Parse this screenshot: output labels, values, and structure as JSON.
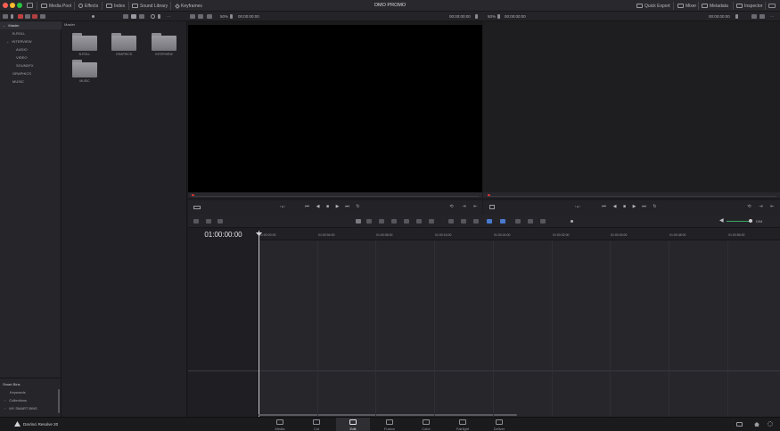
{
  "window": {
    "project_title": "OMO PROMO",
    "panels": [
      {
        "label": "Media Pool",
        "icon": "media-pool-icon"
      },
      {
        "label": "Effects",
        "icon": "effects-icon"
      },
      {
        "label": "Index",
        "icon": "index-icon"
      },
      {
        "label": "Sound Library",
        "icon": "sound-library-icon"
      },
      {
        "label": "Keyframes",
        "icon": "keyframes-icon"
      }
    ],
    "right_panels": [
      {
        "label": "Quick Export",
        "icon": "export-icon"
      },
      {
        "label": "Mixer",
        "icon": "mixer-icon"
      },
      {
        "label": "Metadata",
        "icon": "metadata-icon"
      },
      {
        "label": "Inspector",
        "icon": "inspector-icon"
      }
    ]
  },
  "viewer_toolbar": {
    "source_zoom": "50%",
    "source_tc_left": "00:00:00:00",
    "source_tc_right": "00:00:00:00",
    "timeline_zoom": "50%",
    "timeline_tc_left": "00:00:00:00",
    "timeline_tc_right": "00:00:00:00"
  },
  "bins": {
    "root": "Master",
    "items": [
      {
        "label": "B-ROLL",
        "indent": 1
      },
      {
        "label": "INTERVIEW",
        "indent": 0,
        "expanded": true
      },
      {
        "label": "AUDIO",
        "indent": 2
      },
      {
        "label": "VIDEO",
        "indent": 2
      },
      {
        "label": "SOUNDFX",
        "indent": 2
      },
      {
        "label": "GRAPHICS",
        "indent": 1
      },
      {
        "label": "MUSIC",
        "indent": 1
      }
    ],
    "smart_bins_header": "Smart Bins",
    "smart_bins": [
      {
        "label": "Keywords",
        "chevron": false
      },
      {
        "label": "Collections",
        "chevron": true
      },
      {
        "label": "MY SMART BINS",
        "chevron": true
      }
    ]
  },
  "media_pool": {
    "breadcrumb": "Master",
    "folders": [
      "B-ROLL",
      "GRAPHICS",
      "INTERVIEW",
      "MUSIC"
    ]
  },
  "timeline": {
    "timecode": "01:00:00:00",
    "ruler_labels": [
      "01:00:00:00",
      "01:00:04:00",
      "01:00:08:00",
      "01:00:16:00",
      "01:00:24:00",
      "01:00:32:00",
      "01:00:40:00",
      "01:00:48:00",
      "01:00:56:00"
    ],
    "zoom_label": "DIM"
  },
  "app": {
    "name": "DaVinci Resolve 20"
  },
  "pages": [
    {
      "label": "Media",
      "icon": "media-page-icon",
      "active": false
    },
    {
      "label": "Cut",
      "icon": "cut-page-icon",
      "active": false
    },
    {
      "label": "Edit",
      "icon": "edit-page-icon",
      "active": true
    },
    {
      "label": "Fusion",
      "icon": "fusion-page-icon",
      "active": false
    },
    {
      "label": "Color",
      "icon": "color-page-icon",
      "active": false
    },
    {
      "label": "Fairlight",
      "icon": "fairlight-page-icon",
      "active": false
    },
    {
      "label": "Deliver",
      "icon": "deliver-page-icon",
      "active": false
    }
  ]
}
